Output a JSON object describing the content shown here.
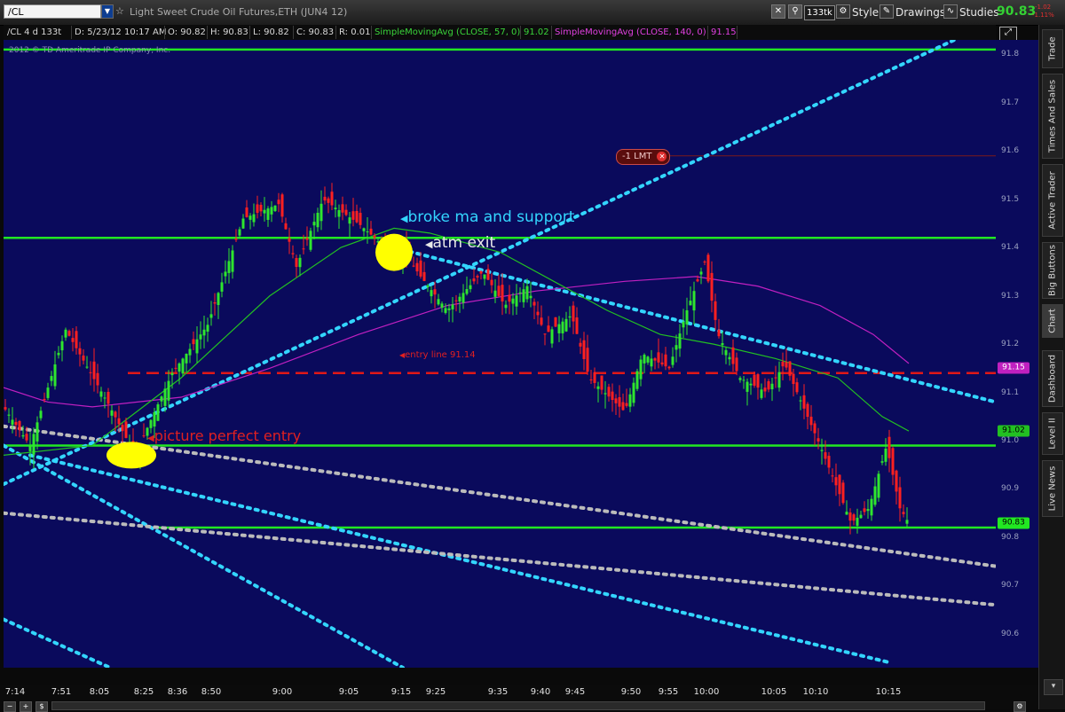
{
  "toolbar": {
    "symbol": "/CL",
    "instrument_title": "Light Sweet Crude Oil Futures,ETH (JUN4 12)",
    "tick_badge": "133tk",
    "style_label": "Style",
    "drawings_label": "Drawings",
    "studies_label": "Studies",
    "last_price": "90.83",
    "change_abs": "-1.02",
    "change_pct": "-1.11%"
  },
  "info_bar": {
    "chart_desc": "/CL 4 d 133t",
    "datetime": "D: 5/23/12 10:17 AM",
    "open": "O: 90.82",
    "high": "H: 90.83",
    "low": "L: 90.82",
    "close": "C: 90.83",
    "range": "R: 0.01",
    "sma1_label": "SimpleMovingAvg (CLOSE, 57, 0)",
    "sma1_value": "91.02",
    "sma2_label": "SimpleMovingAvg (CLOSE, 140, 0)",
    "sma2_value": "91.15"
  },
  "copyright": "2012 © TD Ameritrade IP Company, Inc.",
  "annotations": {
    "broke": "broke ma and support",
    "atm_exit": "atm exit",
    "entry_line": "entry line 91.14",
    "picture_perfect": "picture perfect entry",
    "lmt_order": "-1 LMT"
  },
  "price_tags": {
    "sma140": "91.15",
    "sma57": "91.02",
    "last": "90.83"
  },
  "sidebar": {
    "tabs": [
      "Trade",
      "Times And Sales",
      "Active Trader",
      "Big Buttons",
      "Chart",
      "Dashboard",
      "Level II",
      "Live News"
    ]
  },
  "colors": {
    "background": "#0a0a5c",
    "up_candle": "#2ee62e",
    "down_candle": "#ff2020",
    "sma57": "#22c022",
    "sma140": "#c020c0",
    "support_line": "#22e822",
    "entry_line": "#e01818",
    "trendline_cyan": "#33d6ff",
    "trendline_gray": "#bbbbbb",
    "highlight": "#ffff00"
  },
  "chart_data": {
    "type": "candlestick",
    "symbol": "/CL",
    "ylim": [
      90.53,
      91.83
    ],
    "y_ticks": [
      90.6,
      90.7,
      90.8,
      90.9,
      91.0,
      91.1,
      91.2,
      91.3,
      91.4,
      91.5,
      91.6,
      91.7,
      91.8
    ],
    "x_tick_labels": [
      "7:14",
      "7:51",
      "8:05",
      "8:25",
      "8:36",
      "8:50",
      "9:00",
      "9:05",
      "9:15",
      "9:25",
      "9:35",
      "9:40",
      "9:45",
      "9:50",
      "9:55",
      "10:00",
      "10:05",
      "10:10",
      "10:15"
    ],
    "close_path_samples": [
      [
        0,
        91.07
      ],
      [
        30,
        90.99
      ],
      [
        70,
        91.23
      ],
      [
        120,
        91.07
      ],
      [
        148,
        90.97
      ],
      [
        190,
        91.14
      ],
      [
        230,
        91.24
      ],
      [
        270,
        91.46
      ],
      [
        310,
        91.49
      ],
      [
        330,
        91.36
      ],
      [
        360,
        91.5
      ],
      [
        400,
        91.45
      ],
      [
        430,
        91.4
      ],
      [
        455,
        91.38
      ],
      [
        470,
        91.34
      ],
      [
        500,
        91.27
      ],
      [
        540,
        91.35
      ],
      [
        565,
        91.28
      ],
      [
        590,
        91.32
      ],
      [
        610,
        91.22
      ],
      [
        640,
        91.26
      ],
      [
        660,
        91.13
      ],
      [
        700,
        91.06
      ],
      [
        720,
        91.18
      ],
      [
        750,
        91.15
      ],
      [
        770,
        91.27
      ],
      [
        790,
        91.37
      ],
      [
        805,
        91.22
      ],
      [
        830,
        91.13
      ],
      [
        860,
        91.1
      ],
      [
        880,
        91.16
      ],
      [
        920,
        90.99
      ],
      [
        955,
        90.83
      ],
      [
        975,
        90.86
      ],
      [
        995,
        90.99
      ],
      [
        1010,
        90.86
      ],
      [
        1020,
        90.83
      ]
    ],
    "sma57_samples": [
      [
        0,
        90.97
      ],
      [
        100,
        90.99
      ],
      [
        200,
        91.13
      ],
      [
        300,
        91.3
      ],
      [
        380,
        91.4
      ],
      [
        440,
        91.44
      ],
      [
        480,
        91.43
      ],
      [
        560,
        91.39
      ],
      [
        620,
        91.33
      ],
      [
        680,
        91.27
      ],
      [
        740,
        91.22
      ],
      [
        800,
        91.2
      ],
      [
        870,
        91.17
      ],
      [
        940,
        91.13
      ],
      [
        990,
        91.05
      ],
      [
        1020,
        91.02
      ]
    ],
    "sma140_samples": [
      [
        0,
        91.11
      ],
      [
        50,
        91.08
      ],
      [
        100,
        91.07
      ],
      [
        200,
        91.09
      ],
      [
        300,
        91.15
      ],
      [
        400,
        91.22
      ],
      [
        500,
        91.28
      ],
      [
        600,
        91.31
      ],
      [
        700,
        91.33
      ],
      [
        780,
        91.34
      ],
      [
        850,
        91.32
      ],
      [
        920,
        91.28
      ],
      [
        980,
        91.22
      ],
      [
        1020,
        91.16
      ]
    ],
    "horizontal_lines": [
      {
        "name": "resistance-91.81",
        "y": 91.81,
        "style": "solid",
        "color": "#22e822"
      },
      {
        "name": "support-91.42",
        "y": 91.42,
        "style": "solid",
        "color": "#22e822"
      },
      {
        "name": "entry-line-91.14",
        "y": 91.14,
        "style": "dashed",
        "color": "#e01818",
        "x_start": 140
      },
      {
        "name": "support-90.99",
        "y": 90.99,
        "style": "solid",
        "color": "#22e822"
      },
      {
        "name": "support-90.82",
        "y": 90.82,
        "style": "solid",
        "color": "#22e822",
        "x_start": 170
      },
      {
        "name": "lmt-order-91.59",
        "y": 91.59,
        "style": "thin",
        "color": "#7a1a1a",
        "x_start": 690
      }
    ],
    "trendlines": [
      {
        "name": "cyan-up-steep",
        "color": "#33d6ff",
        "p1": [
          0,
          90.91
        ],
        "p2": [
          1118,
          91.87
        ]
      },
      {
        "name": "cyan-down-upper",
        "color": "#33d6ff",
        "p1": [
          440,
          91.4
        ],
        "p2": [
          1118,
          91.08
        ]
      },
      {
        "name": "cyan-down-lower-1",
        "color": "#33d6ff",
        "p1": [
          0,
          90.99
        ],
        "p2": [
          450,
          90.53
        ]
      },
      {
        "name": "cyan-down-lower-2",
        "color": "#33d6ff",
        "p1": [
          30,
          90.97
        ],
        "p2": [
          1000,
          90.54
        ]
      },
      {
        "name": "cyan-down-lower-3",
        "color": "#33d6ff",
        "p1": [
          0,
          90.63
        ],
        "p2": [
          120,
          90.53
        ]
      },
      {
        "name": "gray-down-1",
        "color": "#bbbbbb",
        "p1": [
          0,
          91.03
        ],
        "p2": [
          1118,
          90.74
        ]
      },
      {
        "name": "gray-down-2",
        "color": "#bbbbbb",
        "p1": [
          0,
          90.85
        ],
        "p2": [
          1118,
          90.66
        ]
      }
    ],
    "highlight_markers": [
      {
        "name": "broke-highlight",
        "center": [
          440,
          91.39
        ],
        "rx": 21,
        "ry": 21
      },
      {
        "name": "entry-highlight",
        "center": [
          144,
          90.97
        ],
        "rx": 28,
        "ry": 15
      }
    ]
  }
}
